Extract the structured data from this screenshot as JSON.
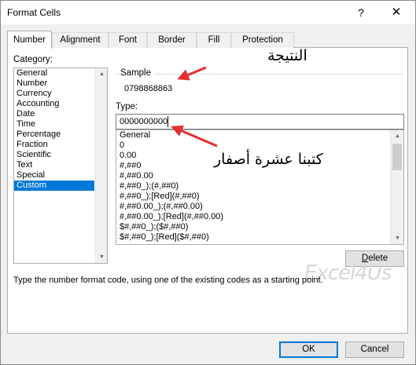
{
  "window": {
    "title": "Format Cells",
    "help_glyph": "?",
    "close_glyph": "✕"
  },
  "tabs": [
    {
      "label": "Number",
      "active": true
    },
    {
      "label": "Alignment",
      "active": false
    },
    {
      "label": "Font",
      "active": false
    },
    {
      "label": "Border",
      "active": false
    },
    {
      "label": "Fill",
      "active": false
    },
    {
      "label": "Protection",
      "active": false
    }
  ],
  "category": {
    "label": "Category:",
    "items": [
      "General",
      "Number",
      "Currency",
      "Accounting",
      "Date",
      "Time",
      "Percentage",
      "Fraction",
      "Scientific",
      "Text",
      "Special",
      "Custom"
    ],
    "selected": "Custom"
  },
  "sample": {
    "label": "Sample",
    "value": "0798868863"
  },
  "type": {
    "label": "Type:",
    "value": "0000000000",
    "formats": [
      "General",
      "0",
      "0.00",
      "#,##0",
      "#,##0.00",
      "#,##0_);(#,##0)",
      "#,##0_);[Red](#,##0)",
      "#,##0.00_);(#,##0.00)",
      "#,##0.00_);[Red](#,##0.00)",
      "$#,##0_);($#,##0)",
      "$#,##0_);[Red]($#,##0)"
    ]
  },
  "buttons": {
    "delete": "Delete",
    "ok": "OK",
    "cancel": "Cancel"
  },
  "hint": "Type the number format code, using one of the existing codes as a starting point.",
  "watermark": "Excel4Us",
  "annotations": {
    "result_label": "النتيجة",
    "zeros_label": "كتبنا عشرة أصفار",
    "arrow_color": "#e03030"
  },
  "colors": {
    "selection": "#0078d7",
    "default_button_border": "#0078d7"
  },
  "icons": {
    "scroll_up": "▲",
    "scroll_down": "▼"
  }
}
